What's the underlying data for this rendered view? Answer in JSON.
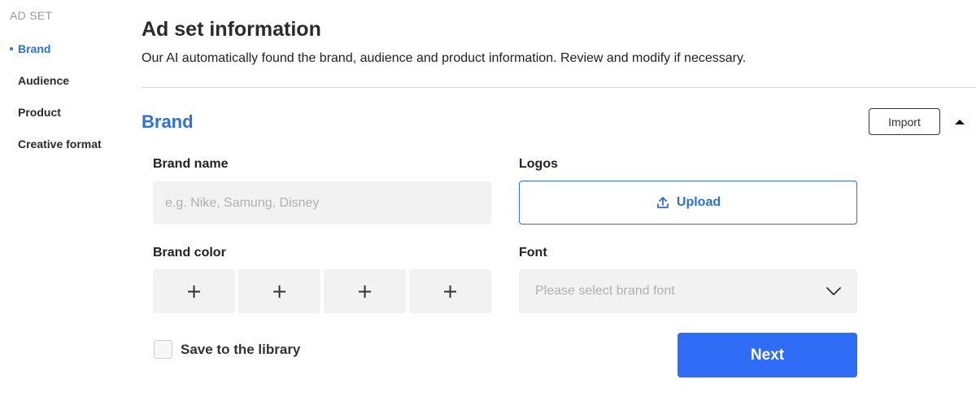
{
  "sidebar": {
    "header": "AD SET",
    "items": [
      {
        "label": "Brand",
        "active": true
      },
      {
        "label": "Audience",
        "active": false
      },
      {
        "label": "Product",
        "active": false
      },
      {
        "label": "Creative format",
        "active": false
      }
    ]
  },
  "header": {
    "title": "Ad set information",
    "subtitle": "Our AI automatically found the brand, audience and product information. Review and modify if necessary."
  },
  "section": {
    "title": "Brand",
    "import_label": "Import",
    "collapse_icon": "caret-up-icon"
  },
  "form": {
    "brand_name": {
      "label": "Brand name",
      "value": "",
      "placeholder": "e.g. Nike, Samung, Disney"
    },
    "logos": {
      "label": "Logos",
      "upload_label": "Upload",
      "icon": "upload-icon"
    },
    "brand_color": {
      "label": "Brand color",
      "swatches": [
        "+",
        "+",
        "+",
        "+"
      ]
    },
    "font": {
      "label": "Font",
      "placeholder": "Please select brand font",
      "icon": "chevron-down-icon"
    },
    "save_to_library": {
      "label": "Save to the library",
      "checked": false
    }
  },
  "actions": {
    "next_label": "Next"
  },
  "colors": {
    "accent": "#2f6fd6",
    "primary_button": "#2f6df6",
    "field_bg": "#f2f2f2"
  }
}
